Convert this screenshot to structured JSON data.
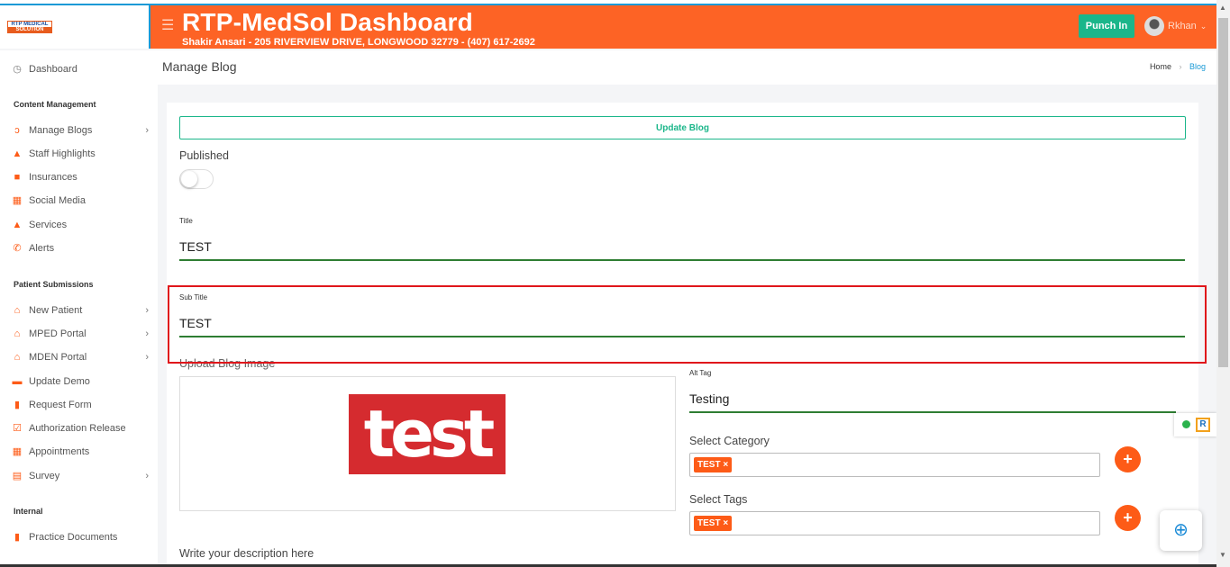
{
  "brand": {
    "logo_top": "RTP MEDICAL",
    "logo_bottom": "SOLUTION"
  },
  "header": {
    "title": "RTP-MedSol Dashboard",
    "subtitle": "Shakir Ansari - 205 RIVERVIEW DRIVE, LONGWOOD 32779 - (407) 617-2692",
    "punch_label": "Punch In",
    "user_name": "Rkhan",
    "accent": "#fd6325"
  },
  "sidebar": {
    "dashboard": "Dashboard",
    "sections": {
      "content": "Content Management",
      "patient": "Patient Submissions",
      "internal": "Internal"
    },
    "content_items": [
      {
        "label": "Manage Blogs"
      },
      {
        "label": "Staff Highlights"
      },
      {
        "label": "Insurances"
      },
      {
        "label": "Social Media"
      },
      {
        "label": "Services"
      },
      {
        "label": "Alerts"
      }
    ],
    "patient_items": [
      {
        "label": "New Patient"
      },
      {
        "label": "MPED Portal"
      },
      {
        "label": "MDEN Portal"
      },
      {
        "label": "Update Demo"
      },
      {
        "label": "Request Form"
      },
      {
        "label": "Authorization Release"
      },
      {
        "label": "Appointments"
      },
      {
        "label": "Survey"
      }
    ],
    "internal_items": [
      {
        "label": "Practice Documents"
      }
    ]
  },
  "page": {
    "title": "Manage Blog",
    "breadcrumb": [
      "Home",
      "Blog"
    ]
  },
  "form": {
    "update_label": "Update Blog",
    "published_label": "Published",
    "title_label": "Title",
    "title_value": "TEST",
    "subtitle_label": "Sub Title",
    "subtitle_value": "TEST",
    "upload_label": "Upload Blog Image",
    "image_text": "test",
    "alt_label": "Alt Tag",
    "alt_value": "Testing",
    "category_label": "Select Category",
    "category_chip": "TEST ×",
    "tags_label": "Select Tags",
    "tags_chip": "TEST ×",
    "description_label": "Write your description here"
  }
}
